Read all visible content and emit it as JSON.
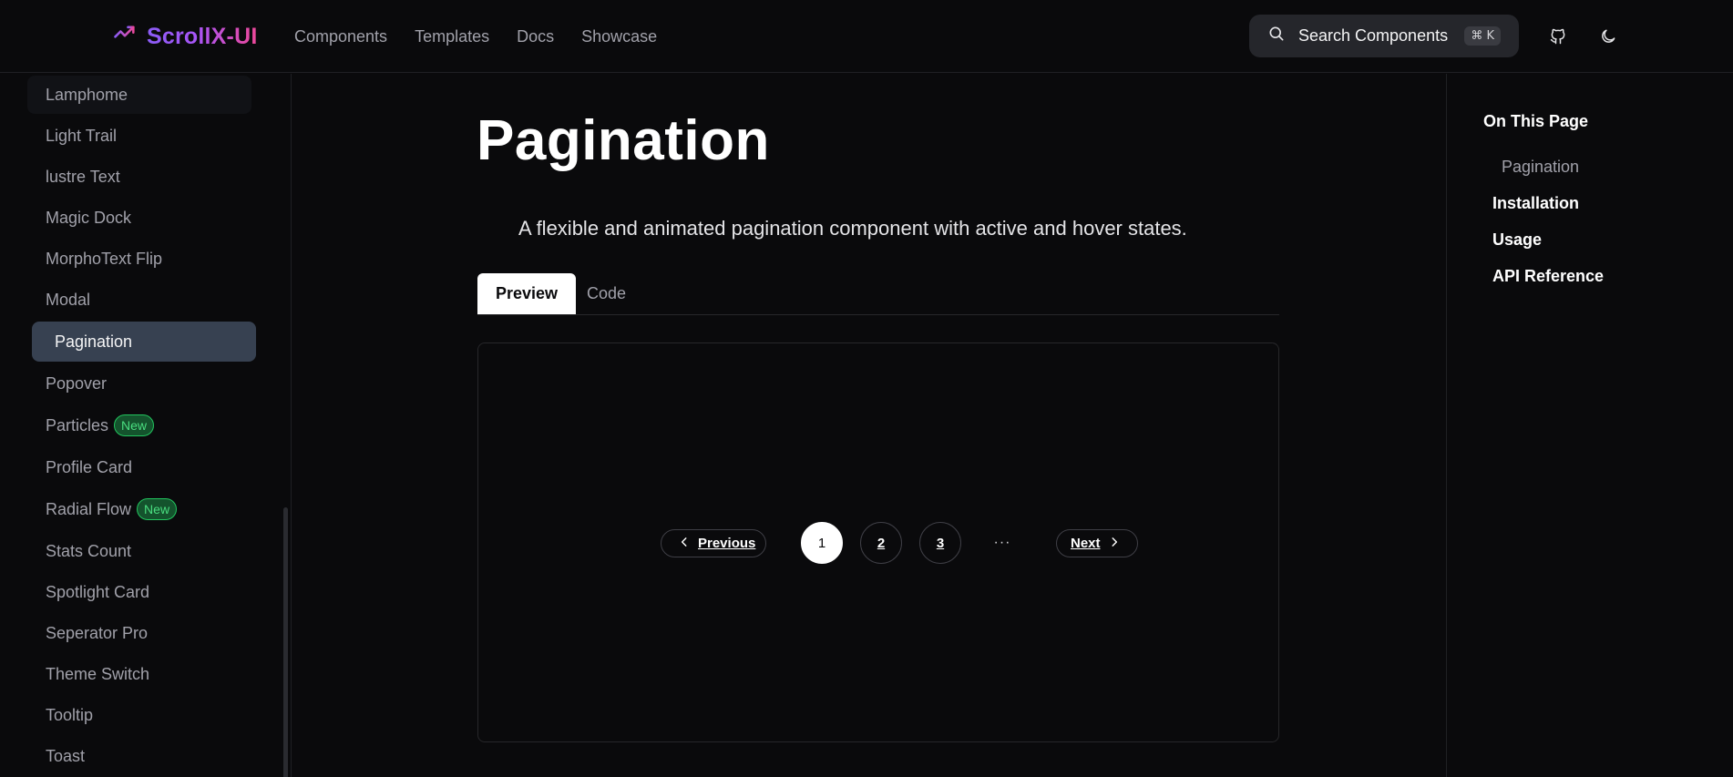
{
  "header": {
    "logo_text": "ScrollX-UI",
    "logo_icon": "chart-trend-icon",
    "nav": [
      "Components",
      "Templates",
      "Docs",
      "Showcase"
    ],
    "search": {
      "label": "Search Components",
      "shortcut": "⌘ K",
      "icon": "search-icon"
    },
    "github_icon": "github-icon",
    "theme_icon": "moon-icon"
  },
  "sidebar": {
    "items": [
      {
        "label": "Lamphome"
      },
      {
        "label": "Light Trail"
      },
      {
        "label": "lustre Text"
      },
      {
        "label": "Magic Dock"
      },
      {
        "label": "MorphoText Flip"
      },
      {
        "label": "Modal"
      },
      {
        "label": "Pagination"
      },
      {
        "label": "Popover"
      },
      {
        "label": "Particles",
        "badge": "New"
      },
      {
        "label": "Profile Card"
      },
      {
        "label": "Radial Flow",
        "badge": "New"
      },
      {
        "label": "Stats Count"
      },
      {
        "label": "Spotlight Card"
      },
      {
        "label": "Seperator Pro"
      },
      {
        "label": "Theme Switch"
      },
      {
        "label": "Tooltip"
      },
      {
        "label": "Toast"
      }
    ]
  },
  "main": {
    "title": "Pagination",
    "description": "A flexible and animated pagination component with active and hover states.",
    "tabs": [
      "Preview",
      "Code"
    ],
    "pagination": {
      "prev_label": "Previous",
      "next_label": "Next",
      "pages": [
        "1",
        "2",
        "3"
      ],
      "ellipsis": "···",
      "current_page": "1"
    }
  },
  "toc": {
    "title": "On This Page",
    "links": [
      "Pagination",
      "Installation",
      "Usage",
      "API Reference"
    ]
  },
  "colors": {
    "background": "#0a0a0c",
    "sidebar_active": "#374151",
    "logo_gradient_start": "#8b5cf6",
    "logo_gradient_end": "#ec4899",
    "badge_green": "#22c55e"
  }
}
